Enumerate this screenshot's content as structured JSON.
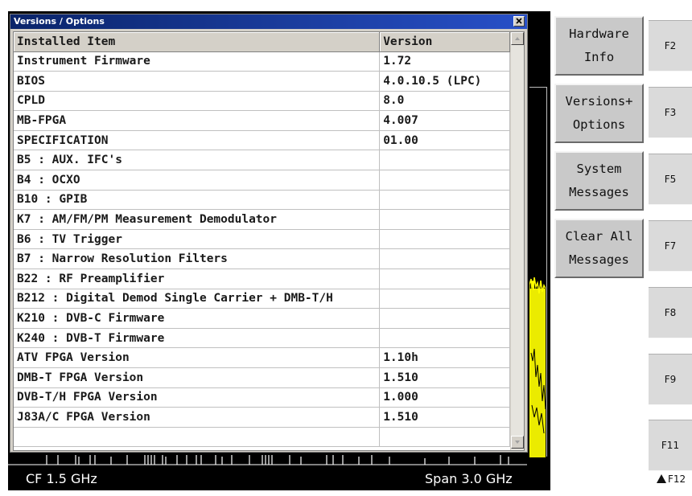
{
  "dialog": {
    "title": "Versions / Options",
    "columns": {
      "item": "Installed Item",
      "version": "Version"
    },
    "rows": [
      {
        "item": "Instrument Firmware",
        "version": "1.72"
      },
      {
        "item": "BIOS",
        "version": "4.0.10.5 (LPC)"
      },
      {
        "item": "CPLD",
        "version": "8.0"
      },
      {
        "item": "MB-FPGA",
        "version": "4.007"
      },
      {
        "item": "SPECIFICATION",
        "version": "01.00"
      },
      {
        "item": "B5 : AUX. IFC's",
        "version": ""
      },
      {
        "item": "B4 : OCXO",
        "version": ""
      },
      {
        "item": "B10 : GPIB",
        "version": ""
      },
      {
        "item": "K7 : AM/FM/PM Measurement Demodulator",
        "version": ""
      },
      {
        "item": "B6 : TV Trigger",
        "version": ""
      },
      {
        "item": "B7 : Narrow Resolution Filters",
        "version": ""
      },
      {
        "item": "B22 : RF Preamplifier",
        "version": ""
      },
      {
        "item": "B212 : Digital Demod Single Carrier + DMB-T/H",
        "version": ""
      },
      {
        "item": "K210 : DVB-C Firmware",
        "version": ""
      },
      {
        "item": "K240 : DVB-T Firmware",
        "version": ""
      },
      {
        "item": "ATV FPGA Version",
        "version": "1.10h"
      },
      {
        "item": "DMB-T FPGA Version",
        "version": "1.510"
      },
      {
        "item": "DVB-T/H FPGA Version",
        "version": "1.000"
      },
      {
        "item": "J83A/C FPGA Version",
        "version": "1.510"
      },
      {
        "item": "",
        "version": ""
      }
    ]
  },
  "softkeys": [
    {
      "line1": "Hardware",
      "line2": "Info"
    },
    {
      "line1": "Versions+",
      "line2": "Options"
    },
    {
      "line1": "System",
      "line2": "Messages"
    },
    {
      "line1": "Clear All",
      "line2": "Messages"
    }
  ],
  "fkeys": [
    "F2",
    "F3",
    "F5",
    "F7",
    "F8",
    "F9",
    "F11"
  ],
  "f12": {
    "label": "F12",
    "icon": "up-triangle-icon"
  },
  "status": {
    "center_frequency": "CF 1.5 GHz",
    "span": "Span 3.0 GHz"
  },
  "colors": {
    "trace": "#ffff00",
    "title_bar": "#0a246a",
    "panel": "#d4d0c8"
  }
}
